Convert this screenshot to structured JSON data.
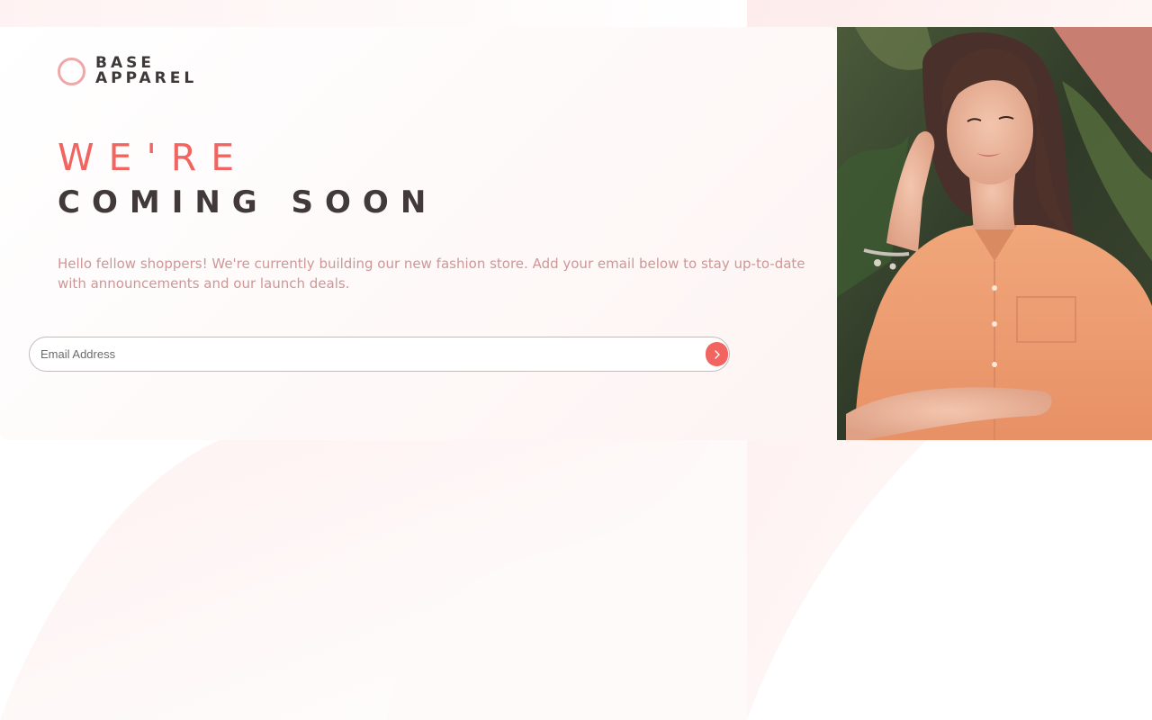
{
  "brand": {
    "line1": "BASE",
    "line2": "APPAREL",
    "accent_color": "#f0a7a7"
  },
  "headline": {
    "accent": "WE'RE",
    "main": "COMING SOON"
  },
  "intro": {
    "text": "Hello fellow shoppers! We're currently building our new fashion store. Add your email below to stay up-to-date with announcements and our launch deals."
  },
  "form": {
    "email_placeholder": "Email Address",
    "email_value": "",
    "submit_icon": "chevron-right-icon"
  },
  "hero": {
    "image": "woman-orange-shirt-photo"
  },
  "colors": {
    "primary": "#f2645f",
    "text_dark": "#423a3a",
    "text_soft": "#ce9797",
    "background": "#fdf4f3"
  }
}
